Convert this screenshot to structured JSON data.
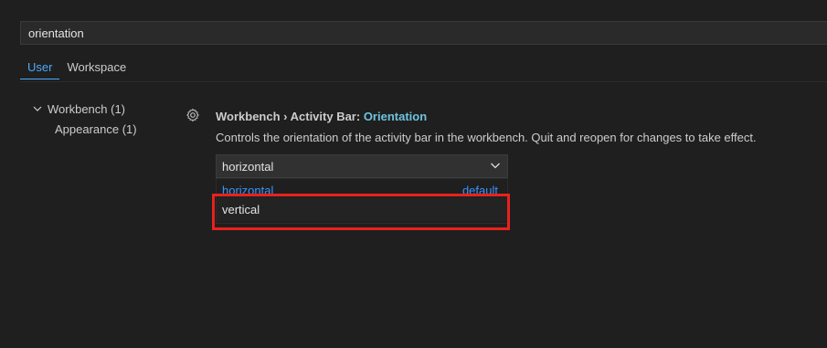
{
  "search": {
    "value": "orientation",
    "placeholder": ""
  },
  "tabs": [
    {
      "label": "User",
      "active": true
    },
    {
      "label": "Workspace",
      "active": false
    }
  ],
  "toc": {
    "group_label": "Workbench (1)",
    "child_label": "Appearance (1)"
  },
  "setting": {
    "title_prefix": "Workbench › Activity Bar: ",
    "title_key": "Orientation",
    "description": "Controls the orientation of the activity bar in the workbench. Quit and reopen for changes to take effect.",
    "selected_value": "horizontal",
    "options": [
      {
        "label": "horizontal",
        "tag": "default"
      },
      {
        "label": "vertical",
        "tag": ""
      }
    ]
  },
  "colors": {
    "accent": "#4daafc",
    "highlight_border": "#e8221b",
    "background": "#1f1f1f"
  },
  "icons": [
    "gear-icon",
    "chevron-down-icon"
  ]
}
